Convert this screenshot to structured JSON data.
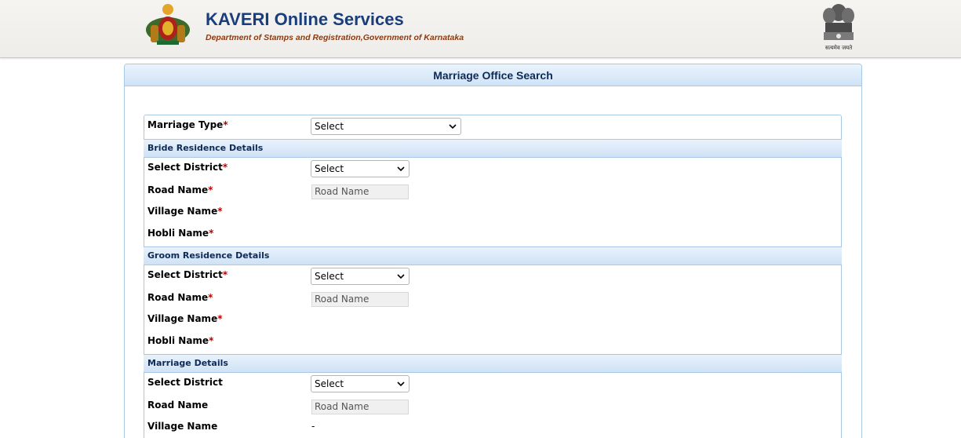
{
  "header": {
    "title": "KAVERI Online Services",
    "subtitle": "Department of Stamps and Registration,Government of Karnataka",
    "emblem_caption": "सत्यमेव जयते"
  },
  "panel": {
    "title": "Marriage Office Search"
  },
  "form": {
    "marriage_type": {
      "label": "Marriage Type",
      "required": "*",
      "value": "Select"
    },
    "bride": {
      "section_title": "Bride Residence Details",
      "district": {
        "label": "Select District",
        "required": "*",
        "value": "Select"
      },
      "road": {
        "label": "Road Name",
        "required": "*",
        "placeholder": "Road Name"
      },
      "village": {
        "label": "Village Name",
        "required": "*"
      },
      "hobli": {
        "label": "Hobli Name",
        "required": "*"
      }
    },
    "groom": {
      "section_title": "Groom Residence Details",
      "district": {
        "label": "Select District",
        "required": "*",
        "value": "Select"
      },
      "road": {
        "label": "Road Name",
        "required": "*",
        "placeholder": "Road Name"
      },
      "village": {
        "label": "Village Name",
        "required": "*"
      },
      "hobli": {
        "label": "Hobli Name",
        "required": "*"
      }
    },
    "marriage": {
      "section_title": "Marriage Details",
      "district": {
        "label": "Select District",
        "value": "Select"
      },
      "road": {
        "label": "Road Name",
        "placeholder": "Road Name"
      },
      "village": {
        "label": "Village Name",
        "value": "-"
      }
    }
  },
  "colors": {
    "brand": "#1a3d7c",
    "subtitle": "#8a3a12",
    "required": "#c00000",
    "section_border": "#a9c8e6"
  },
  "icons": {
    "left_logo": "karnataka-emblem-icon",
    "right_logo": "ashoka-emblem-icon",
    "dropdown": "chevron-down-icon"
  }
}
